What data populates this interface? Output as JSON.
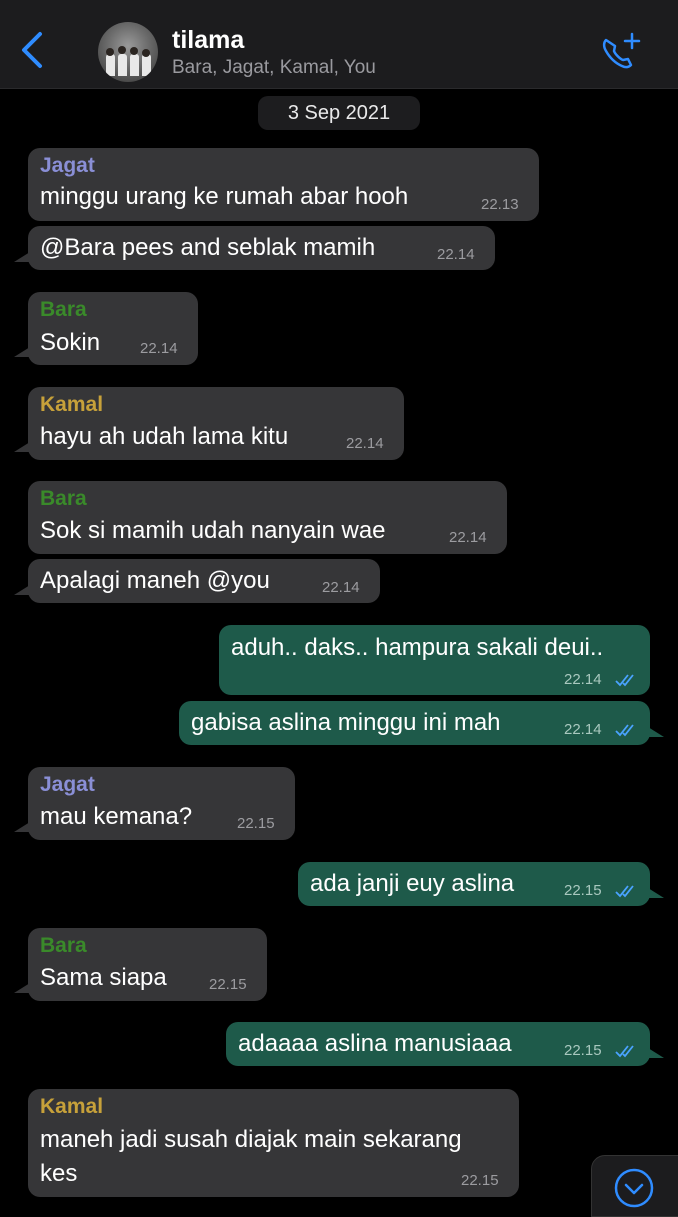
{
  "header": {
    "title": "tilama",
    "members": "Bara, Jagat, Kamal, You"
  },
  "date": "3 Sep 2021",
  "colors": {
    "incoming": "#363638",
    "outgoing": "#1e5a4a",
    "sender_jagat": "#8a8fd6",
    "sender_bara": "#3a8a2a",
    "sender_kamal": "#c7a13a",
    "accent": "#2f8cff"
  },
  "messages": [
    {
      "sender": "Jagat",
      "text": "minggu urang ke rumah abar hooh",
      "time": "22.13"
    },
    {
      "text": "@Bara pees and seblak mamih",
      "time": "22.14"
    },
    {
      "sender": "Bara",
      "text": "Sokin",
      "time": "22.14"
    },
    {
      "sender": "Kamal",
      "text": "hayu ah udah lama kitu",
      "time": "22.14"
    },
    {
      "sender": "Bara",
      "text": "Sok si mamih udah nanyain wae",
      "time": "22.14"
    },
    {
      "text": "Apalagi maneh @you",
      "time": "22.14"
    },
    {
      "text": "aduh.. daks.. hampura sakali deui..",
      "time": "22.14"
    },
    {
      "text": "gabisa aslina minggu ini mah",
      "time": "22.14"
    },
    {
      "sender": "Jagat",
      "text": "mau kemana?",
      "time": "22.15"
    },
    {
      "text": "ada janji euy aslina",
      "time": "22.15"
    },
    {
      "sender": "Bara",
      "text": "Sama siapa",
      "time": "22.15"
    },
    {
      "text": "adaaaa aslina manusiaaa",
      "time": "22.15"
    },
    {
      "sender": "Kamal",
      "text_line1": "maneh jadi susah diajak main sekarang",
      "text_line2": "kes",
      "time": "22.15"
    }
  ]
}
